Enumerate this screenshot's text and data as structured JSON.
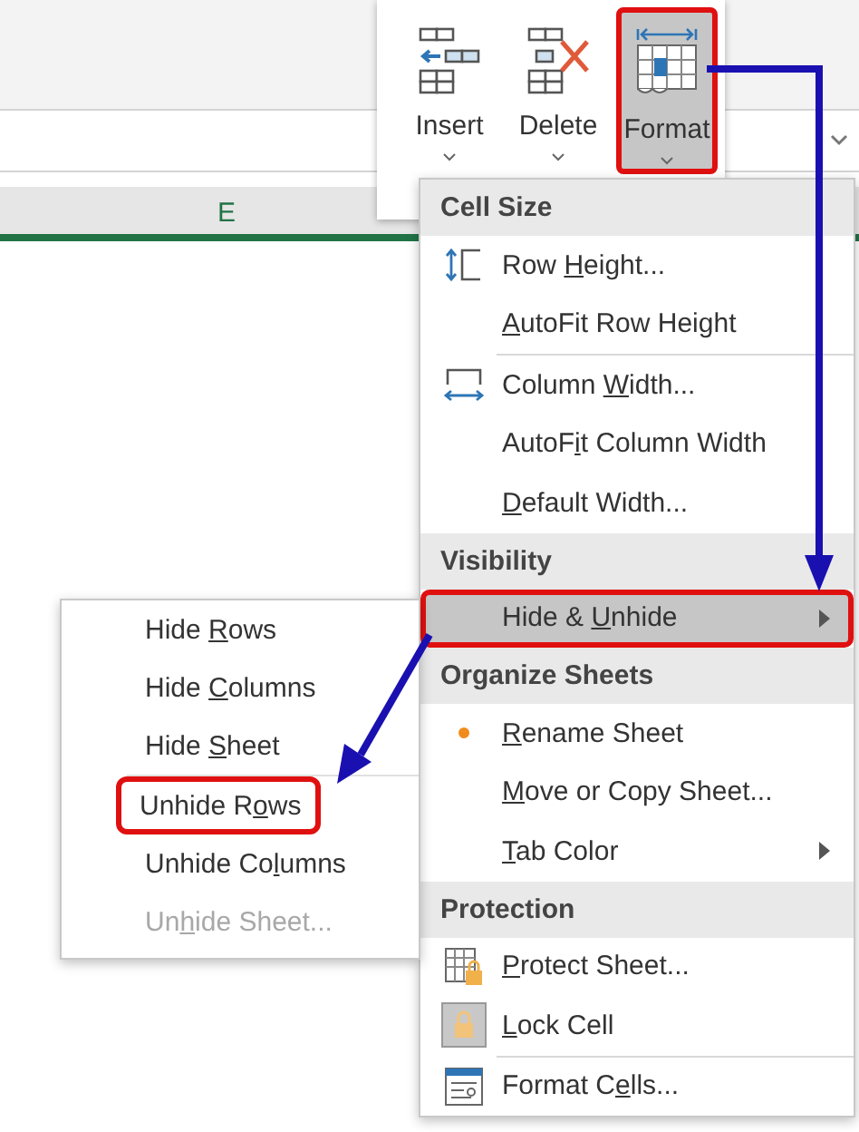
{
  "ribbon": {
    "buttons": [
      {
        "label": "Insert",
        "kind": "insert",
        "selected": false,
        "highlighted": false
      },
      {
        "label": "Delete",
        "kind": "delete",
        "selected": false,
        "highlighted": false
      },
      {
        "label": "Format",
        "kind": "format",
        "selected": true,
        "highlighted": true
      }
    ]
  },
  "sheet": {
    "column_header": "E"
  },
  "menu": {
    "sections": [
      {
        "header": "Cell Size",
        "items": [
          {
            "label": [
              {
                "text": "Row "
              },
              {
                "text": "H",
                "underline": true
              },
              {
                "text": "eight..."
              }
            ],
            "kind": "row-height",
            "divider_before": false,
            "submenu": false,
            "selected": false,
            "highlighted": false,
            "bullet": false
          },
          {
            "label": [
              {
                "text": "A",
                "underline": true
              },
              {
                "text": "utoFit Row Height"
              }
            ],
            "divider_before": false,
            "submenu": false,
            "selected": false,
            "highlighted": false,
            "bullet": false
          },
          {
            "label": [
              {
                "text": "Column "
              },
              {
                "text": "W",
                "underline": true
              },
              {
                "text": "idth..."
              }
            ],
            "kind": "column-width",
            "divider_before": true,
            "submenu": false,
            "selected": false,
            "highlighted": false,
            "bullet": false
          },
          {
            "label": [
              {
                "text": "AutoF"
              },
              {
                "text": "i",
                "underline": true
              },
              {
                "text": "t Column Width"
              }
            ],
            "divider_before": false,
            "submenu": false,
            "selected": false,
            "highlighted": false,
            "bullet": false
          },
          {
            "label": [
              {
                "text": "D",
                "underline": true
              },
              {
                "text": "efault Width..."
              }
            ],
            "divider_before": false,
            "submenu": false,
            "selected": false,
            "highlighted": false,
            "bullet": false
          }
        ]
      },
      {
        "header": "Visibility",
        "items": [
          {
            "label": [
              {
                "text": "Hide & "
              },
              {
                "text": "U",
                "underline": true
              },
              {
                "text": "nhide"
              }
            ],
            "divider_before": false,
            "submenu": true,
            "selected": true,
            "highlighted": true,
            "bullet": false
          }
        ]
      },
      {
        "header": "Organize Sheets",
        "items": [
          {
            "label": [
              {
                "text": "R",
                "underline": true
              },
              {
                "text": "ename Sheet"
              }
            ],
            "divider_before": false,
            "submenu": false,
            "selected": false,
            "highlighted": false,
            "bullet": true
          },
          {
            "label": [
              {
                "text": "M",
                "underline": true
              },
              {
                "text": "ove or Copy Sheet..."
              }
            ],
            "divider_before": false,
            "submenu": false,
            "selected": false,
            "highlighted": false,
            "bullet": false
          },
          {
            "label": [
              {
                "text": "T",
                "underline": true
              },
              {
                "text": "ab Color"
              }
            ],
            "divider_before": false,
            "submenu": true,
            "selected": false,
            "highlighted": false,
            "bullet": false
          }
        ]
      },
      {
        "header": "Protection",
        "items": [
          {
            "label": [
              {
                "text": "P",
                "underline": true
              },
              {
                "text": "rotect Sheet..."
              }
            ],
            "kind": "protect",
            "divider_before": false,
            "submenu": false,
            "selected": false,
            "highlighted": false,
            "bullet": false
          },
          {
            "label": [
              {
                "text": "L",
                "underline": true
              },
              {
                "text": "ock Cell"
              }
            ],
            "kind": "lock",
            "divider_before": false,
            "submenu": false,
            "selected": false,
            "highlighted": false,
            "bullet": false
          },
          {
            "label": [
              {
                "text": "Format C"
              },
              {
                "text": "e",
                "underline": true
              },
              {
                "text": "lls..."
              }
            ],
            "kind": "format-cells",
            "divider_before": true,
            "submenu": false,
            "selected": false,
            "highlighted": false,
            "bullet": false
          }
        ]
      }
    ]
  },
  "submenu": {
    "items": [
      {
        "label": [
          {
            "text": "Hide "
          },
          {
            "text": "R",
            "underline": true
          },
          {
            "text": "ows"
          }
        ],
        "disabled": false,
        "highlighted": false,
        "divider_before": false
      },
      {
        "label": [
          {
            "text": "Hide "
          },
          {
            "text": "C",
            "underline": true
          },
          {
            "text": "olumns"
          }
        ],
        "disabled": false,
        "highlighted": false,
        "divider_before": false
      },
      {
        "label": [
          {
            "text": "Hide "
          },
          {
            "text": "S",
            "underline": true
          },
          {
            "text": "heet"
          }
        ],
        "disabled": false,
        "highlighted": false,
        "divider_before": false
      },
      {
        "label": [
          {
            "text": "Unhide R"
          },
          {
            "text": "o",
            "underline": true
          },
          {
            "text": "ws"
          }
        ],
        "disabled": false,
        "highlighted": true,
        "divider_before": true
      },
      {
        "label": [
          {
            "text": "Unhide Co"
          },
          {
            "text": "l",
            "underline": true
          },
          {
            "text": "umns"
          }
        ],
        "disabled": false,
        "highlighted": false,
        "divider_before": false
      },
      {
        "label": [
          {
            "text": "Un"
          },
          {
            "text": "h",
            "underline": true
          },
          {
            "text": "ide Sheet..."
          }
        ],
        "disabled": true,
        "highlighted": false,
        "divider_before": false
      }
    ]
  }
}
